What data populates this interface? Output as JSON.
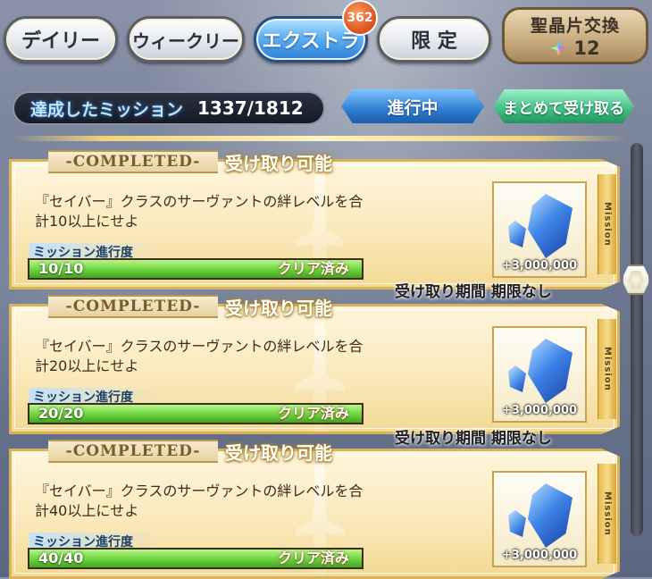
{
  "tabs": {
    "daily": "デイリー",
    "weekly": "ウィークリー",
    "extra": "エクストラ",
    "limited": "限 定",
    "extra_badge": "362"
  },
  "exchange": {
    "label": "聖晶片交換",
    "count": "12",
    "icon": "saint-quartz-fragment-icon"
  },
  "status": {
    "label": "達成したミッション",
    "count": "1337/1812",
    "in_progress_label": "進行中",
    "collect_all_label": "まとめて受け取る"
  },
  "missions": [
    {
      "completed_label": "-COMPLETED-",
      "claimable_label": "受け取り可能",
      "desc_line1": "『セイバー』クラスのサーヴァントの絆レベルを合",
      "desc_line2": "計10以上にせよ",
      "progress_label": "ミッション進行度",
      "progress_value": "10/10",
      "progress_fraction": 1.0,
      "progress_status": "クリア済み",
      "reward_amount": "+3,000,000",
      "reward_icon": "qp-crystal-icon",
      "tag": "Mission",
      "period": "受け取り期間 期限なし"
    },
    {
      "completed_label": "-COMPLETED-",
      "claimable_label": "受け取り可能",
      "desc_line1": "『セイバー』クラスのサーヴァントの絆レベルを合",
      "desc_line2": "計20以上にせよ",
      "progress_label": "ミッション進行度",
      "progress_value": "20/20",
      "progress_fraction": 1.0,
      "progress_status": "クリア済み",
      "reward_amount": "+3,000,000",
      "reward_icon": "qp-crystal-icon",
      "tag": "Mission",
      "period": "受け取り期間 期限なし"
    },
    {
      "completed_label": "-COMPLETED-",
      "claimable_label": "受け取り可能",
      "desc_line1": "『セイバー』クラスのサーヴァントの絆レベルを合",
      "desc_line2": "計40以上にせよ",
      "progress_label": "ミッション進行度",
      "progress_value": "40/40",
      "progress_fraction": 1.0,
      "progress_status": "クリア済み",
      "reward_amount": "+3,000,000",
      "reward_icon": "qp-crystal-icon",
      "tag": "Mission"
    }
  ],
  "colors": {
    "active_tab": "#3a8be0",
    "progress_fill": "#6bd33e",
    "card_gold": "#d8b35c"
  }
}
